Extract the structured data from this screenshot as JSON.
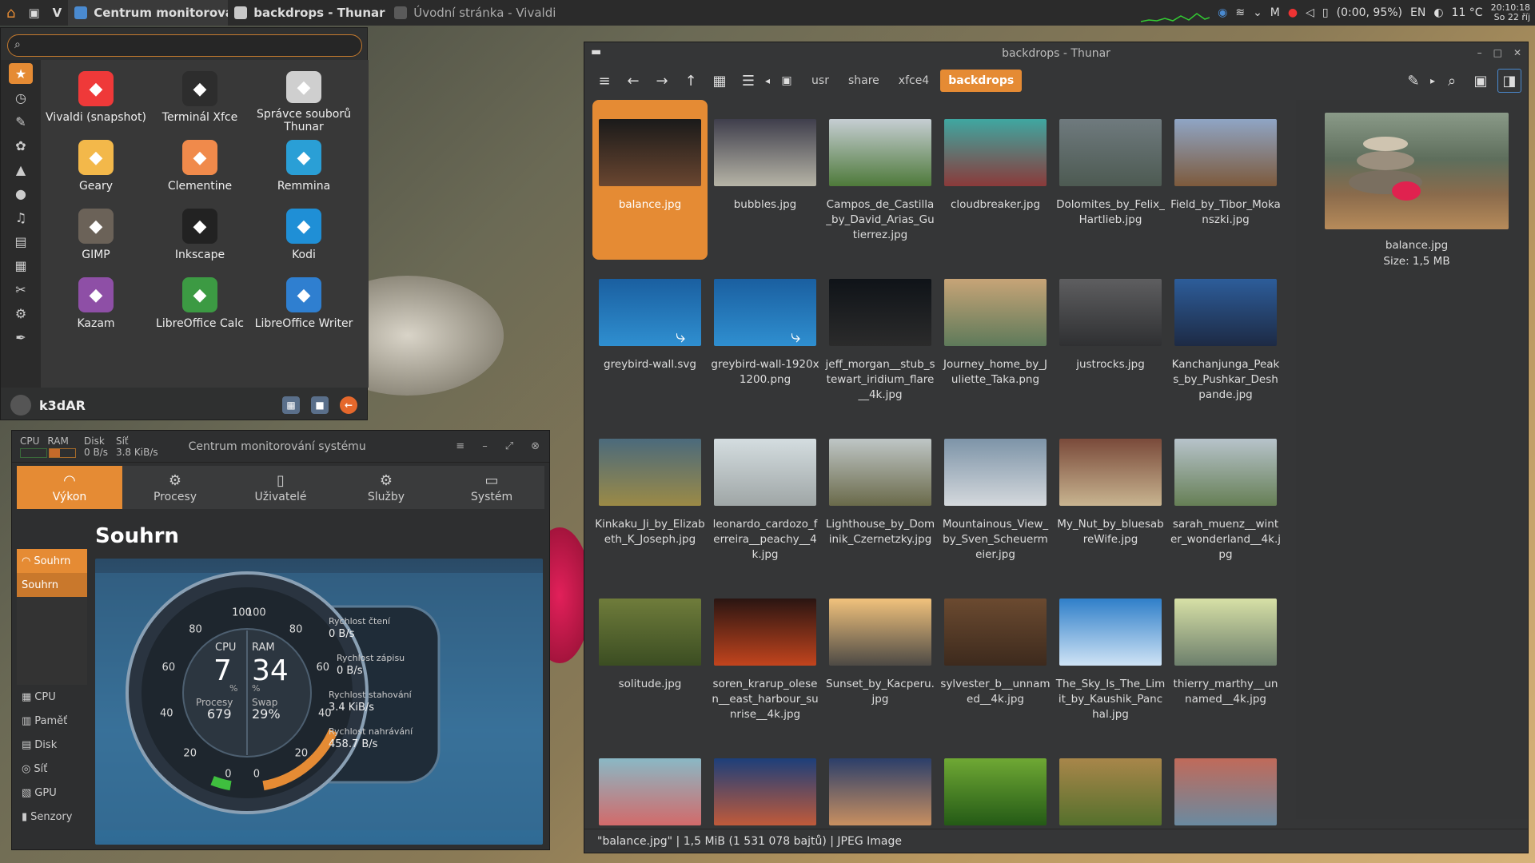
{
  "panel": {
    "tasks": [
      {
        "label": "Centrum monitorování systému"
      },
      {
        "label": "backdrops - Thunar"
      },
      {
        "label": "Úvodní stránka - Vivaldi"
      }
    ],
    "tray": {
      "battery": "(0:00, 95%)",
      "lang": "EN",
      "temp": "11 °C",
      "keyboard": "M",
      "time": "20:10:18",
      "date": "So 22 říj"
    }
  },
  "menu": {
    "apps": [
      {
        "label": "Vivaldi (snapshot)",
        "icon": "vivaldi-icon",
        "color": "#ef3939"
      },
      {
        "label": "Terminál Xfce",
        "icon": "terminal-icon",
        "color": "#2d2d2d"
      },
      {
        "label": "Správce souborů Thunar",
        "icon": "folder-icon",
        "color": "#cfcfcf"
      },
      {
        "label": "Geary",
        "icon": "mail-icon",
        "color": "#f3b84a"
      },
      {
        "label": "Clementine",
        "icon": "clementine-icon",
        "color": "#f08a4b"
      },
      {
        "label": "Remmina",
        "icon": "remmina-icon",
        "color": "#2a9fd6"
      },
      {
        "label": "GIMP",
        "icon": "gimp-icon",
        "color": "#6b6258"
      },
      {
        "label": "Inkscape",
        "icon": "inkscape-icon",
        "color": "#222222"
      },
      {
        "label": "Kodi",
        "icon": "kodi-icon",
        "color": "#1f8fd6"
      },
      {
        "label": "Kazam",
        "icon": "kazam-icon",
        "color": "#8e4fa6"
      },
      {
        "label": "LibreOffice Calc",
        "icon": "calc-icon",
        "color": "#3c9a43"
      },
      {
        "label": "LibreOffice Writer",
        "icon": "writer-icon",
        "color": "#2f7fd0"
      }
    ],
    "username": "k3dAR"
  },
  "monitor": {
    "title": "Centrum monitorování systému",
    "mini": {
      "cpu_label": "CPU",
      "ram_label": "RAM",
      "disk_label": "Disk",
      "disk_value": "0 B/s",
      "net_label": "Síť",
      "net_value": "3.8 KiB/s"
    },
    "tabs": [
      "Výkon",
      "Procesy",
      "Uživatelé",
      "Služby",
      "Systém"
    ],
    "side": [
      "Souhrn",
      "CPU",
      "Paměť",
      "Disk",
      "Síť",
      "GPU",
      "Senzory"
    ],
    "side_sub": "Souhrn",
    "heading": "Souhrn",
    "gauge": {
      "cpu_label": "CPU",
      "cpu_value": "7",
      "cpu_unit": "%",
      "ram_label": "RAM",
      "ram_value": "34",
      "ram_unit": "%",
      "procs_label": "Procesy",
      "procs_value": "679",
      "swap_label": "Swap",
      "swap_value": "29%",
      "ticks_left": [
        "100",
        "80",
        "60",
        "40",
        "20",
        "0"
      ],
      "ticks_right": [
        "100",
        "80",
        "60",
        "40",
        "20",
        "0"
      ],
      "cpu_level": 0.07,
      "ram_level": 0.34
    },
    "rates": [
      {
        "label": "Rychlost čtení",
        "value": "0 B/s"
      },
      {
        "label": "Rychlost zápisu",
        "value": "0 B/s"
      },
      {
        "label": "Rychlost stahování",
        "value": "3.4 KiB/s"
      },
      {
        "label": "Rychlost nahrávání",
        "value": "458.7 B/s"
      }
    ]
  },
  "thunar": {
    "title": "backdrops - Thunar",
    "crumbs": [
      "usr",
      "share",
      "xfce4",
      "backdrops"
    ],
    "files": [
      {
        "name": "balance.jpg",
        "c1": "#1a1a1a",
        "c2": "#6a4630",
        "selected": true
      },
      {
        "name": "bubbles.jpg",
        "c1": "#3f3e4c",
        "c2": "#b6b4a6"
      },
      {
        "name": "Campos_de_Castilla_by_David_Arias_Gutierrez.jpg",
        "c1": "#c6ced3",
        "c2": "#4e7a3a"
      },
      {
        "name": "cloudbreaker.jpg",
        "c1": "#3fa7a1",
        "c2": "#8a3a3a"
      },
      {
        "name": "Dolomites_by_Felix_Hartlieb.jpg",
        "c1": "#6f7a7e",
        "c2": "#4d5a52"
      },
      {
        "name": "Field_by_Tibor_Mokanszki.jpg",
        "c1": "#8fa5c5",
        "c2": "#7d5a3c"
      },
      {
        "name": "greybird-wall.svg",
        "c1": "#1a5fa0",
        "c2": "#2f8fd0",
        "link": true
      },
      {
        "name": "greybird-wall-1920x1200.png",
        "c1": "#1a5fa0",
        "c2": "#2f8fd0",
        "link": true
      },
      {
        "name": "jeff_morgan__stub_stewart_iridium_flare__4k.jpg",
        "c1": "#0f1318",
        "c2": "#2b2b2b"
      },
      {
        "name": "Journey_home_by_Juliette_Taka.png",
        "c1": "#c7a477",
        "c2": "#5e7a5a"
      },
      {
        "name": "justrocks.jpg",
        "c1": "#5e5e60",
        "c2": "#2f3032"
      },
      {
        "name": "Kanchanjunga_Peaks_by_Pushkar_Deshpande.jpg",
        "c1": "#2d5d9a",
        "c2": "#1d2a44"
      },
      {
        "name": "Kinkaku_Ji_by_Elizabeth_K_Joseph.jpg",
        "c1": "#4b6a7c",
        "c2": "#9b8a46"
      },
      {
        "name": "leonardo_cardozo_ferreira__peachy__4k.jpg",
        "c1": "#d4dde0",
        "c2": "#9fa6a6"
      },
      {
        "name": "Lighthouse_by_Dominik_Czernetzky.jpg",
        "c1": "#bfc6c6",
        "c2": "#6a6a4a"
      },
      {
        "name": "Mountainous_View_by_Sven_Scheuermeier.jpg",
        "c1": "#7d94a8",
        "c2": "#d4d8dc"
      },
      {
        "name": "My_Nut_by_bluesabreWife.jpg",
        "c1": "#7a4a3a",
        "c2": "#c8b490"
      },
      {
        "name": "sarah_muenz__winter_wonderland__4k.jpg",
        "c1": "#b7c3cb",
        "c2": "#667f55"
      },
      {
        "name": "solitude.jpg",
        "c1": "#6f7c3b",
        "c2": "#3b4d22"
      },
      {
        "name": "soren_krarup_olesen__east_harbour_sunrise__4k.jpg",
        "c1": "#2a1512",
        "c2": "#c2441d"
      },
      {
        "name": "Sunset_by_Kacperu.jpg",
        "c1": "#f1c27c",
        "c2": "#4d4a45"
      },
      {
        "name": "sylvester_b__unnamed__4k.jpg",
        "c1": "#6b4a30",
        "c2": "#3d2a1d"
      },
      {
        "name": "The_Sky_Is_The_Limit_by_Kaushik_Panchal.jpg",
        "c1": "#2f7fc9",
        "c2": "#cfe3f5"
      },
      {
        "name": "thierry_marthy__unnamed__4k.jpg",
        "c1": "#d7e0a6",
        "c2": "#6d7f6c"
      },
      {
        "name": "",
        "c1": "#8ab8c5",
        "c2": "#d26a6a"
      },
      {
        "name": "",
        "c1": "#1d3f7a",
        "c2": "#c05a3a"
      },
      {
        "name": "",
        "c1": "#2c3f6a",
        "c2": "#c88f60"
      },
      {
        "name": "",
        "c1": "#6fa834",
        "c2": "#245a16"
      },
      {
        "name": "",
        "c1": "#a8864a",
        "c2": "#55702c"
      },
      {
        "name": "",
        "c1": "#c06a5a",
        "c2": "#6a8aa0"
      }
    ],
    "preview": {
      "name": "balance.jpg",
      "size": "Size: 1,5 MB"
    },
    "status": "\"balance.jpg\"  |  1,5 MiB (1 531 078 bajtů)  |  JPEG Image"
  },
  "colors": {
    "accent": "#e58b34",
    "panel": "#2b2b2b"
  }
}
